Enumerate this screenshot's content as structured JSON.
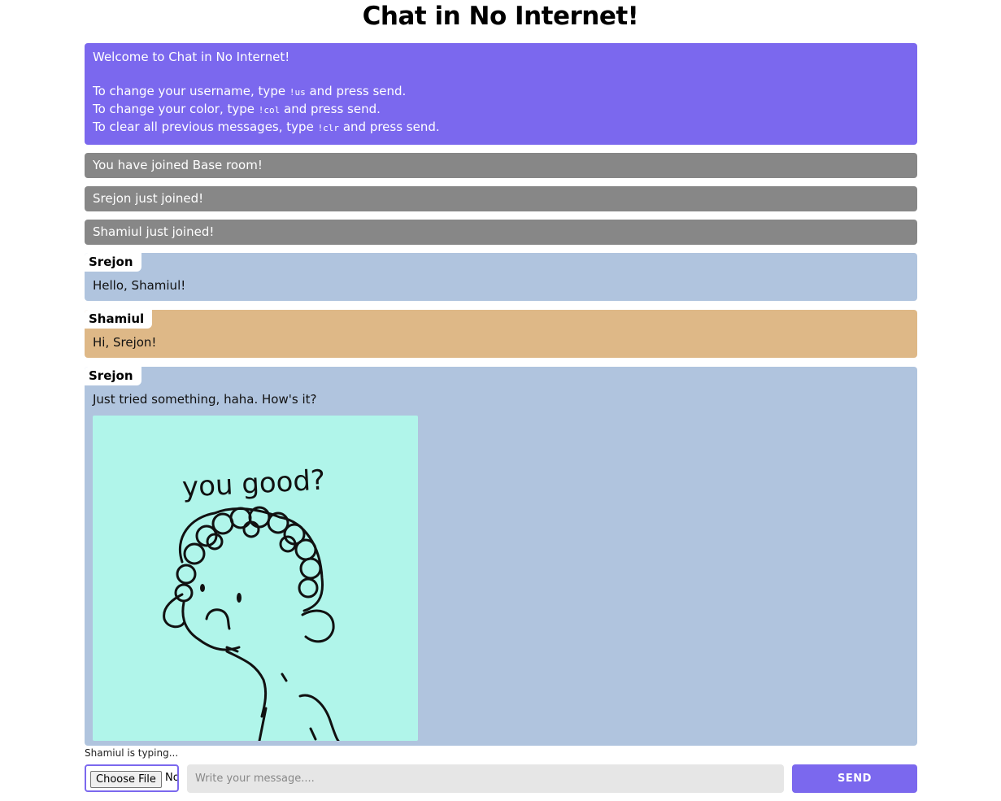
{
  "page": {
    "title": "Chat in No Internet!"
  },
  "welcome": {
    "line1": "Welcome to Chat in No Internet!",
    "username_prefix": "To change your username, type ",
    "username_cmd": "!us",
    "username_suffix": " and press send.",
    "color_prefix": "To change your color, type ",
    "color_cmd": "!col",
    "color_suffix": " and press send.",
    "clear_prefix": "To clear all previous messages, type ",
    "clear_cmd": "!clr",
    "clear_suffix": " and press send.",
    "color": "#7b68ee"
  },
  "system_messages": [
    "You have joined Base room!",
    "Srejon just joined!",
    "Shamiul just joined!"
  ],
  "messages": [
    {
      "user": "Srejon",
      "text": "Hello, Shamiul!",
      "color": "#b0c4de"
    },
    {
      "user": "Shamiul",
      "text": "Hi, Srejon!",
      "color": "#deb887"
    },
    {
      "user": "Srejon",
      "text": "Just tried something, haha. How's it?",
      "color": "#b0c4de",
      "image": {
        "caption": "you good?",
        "background": "#b0f5ea"
      }
    }
  ],
  "typing_indicator": "Shamiul is typing...",
  "composer": {
    "file_button": "Choose File",
    "file_status": "No file chosen",
    "placeholder": "Write your message....",
    "send_label": "SEND"
  }
}
